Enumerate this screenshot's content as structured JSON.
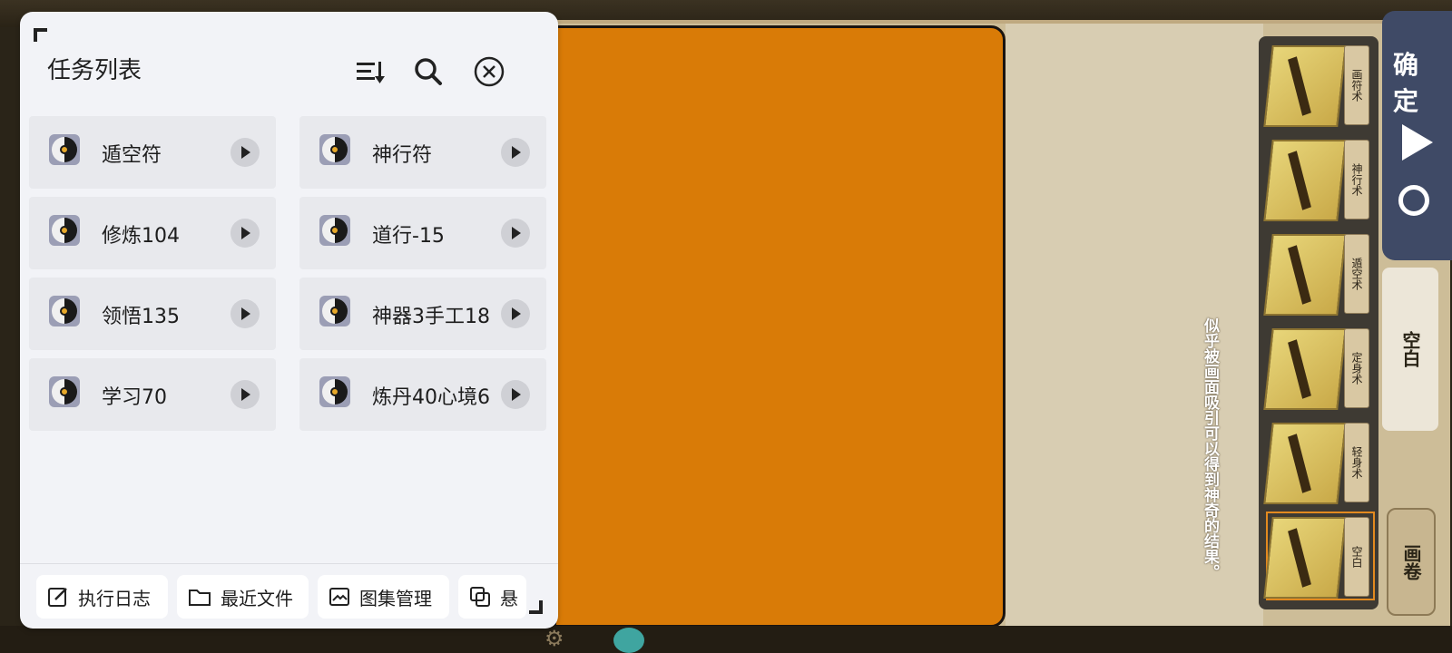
{
  "panel": {
    "title": "任务列表",
    "tasks": [
      {
        "name": "遁空符"
      },
      {
        "name": "神行符"
      },
      {
        "name": "修炼104"
      },
      {
        "name": "道行-15"
      },
      {
        "name": "领悟135"
      },
      {
        "name": "神器3手工18"
      },
      {
        "name": "学习70"
      },
      {
        "name": "炼丹40心境6"
      }
    ],
    "footer": {
      "log": "执行日志",
      "recent": "最近文件",
      "gallery": "图集管理",
      "float": "悬"
    }
  },
  "game": {
    "hint": "似乎被画面吸引可以得到神奇的结果。",
    "blank_label": "空白",
    "scroll_label": "画卷",
    "confirm_label": "确定",
    "cards": [
      {
        "tag": "画符术"
      },
      {
        "tag": "神行术"
      },
      {
        "tag": "遁空术"
      },
      {
        "tag": "定身术"
      },
      {
        "tag": "轻身术"
      },
      {
        "tag": "空白"
      }
    ]
  }
}
